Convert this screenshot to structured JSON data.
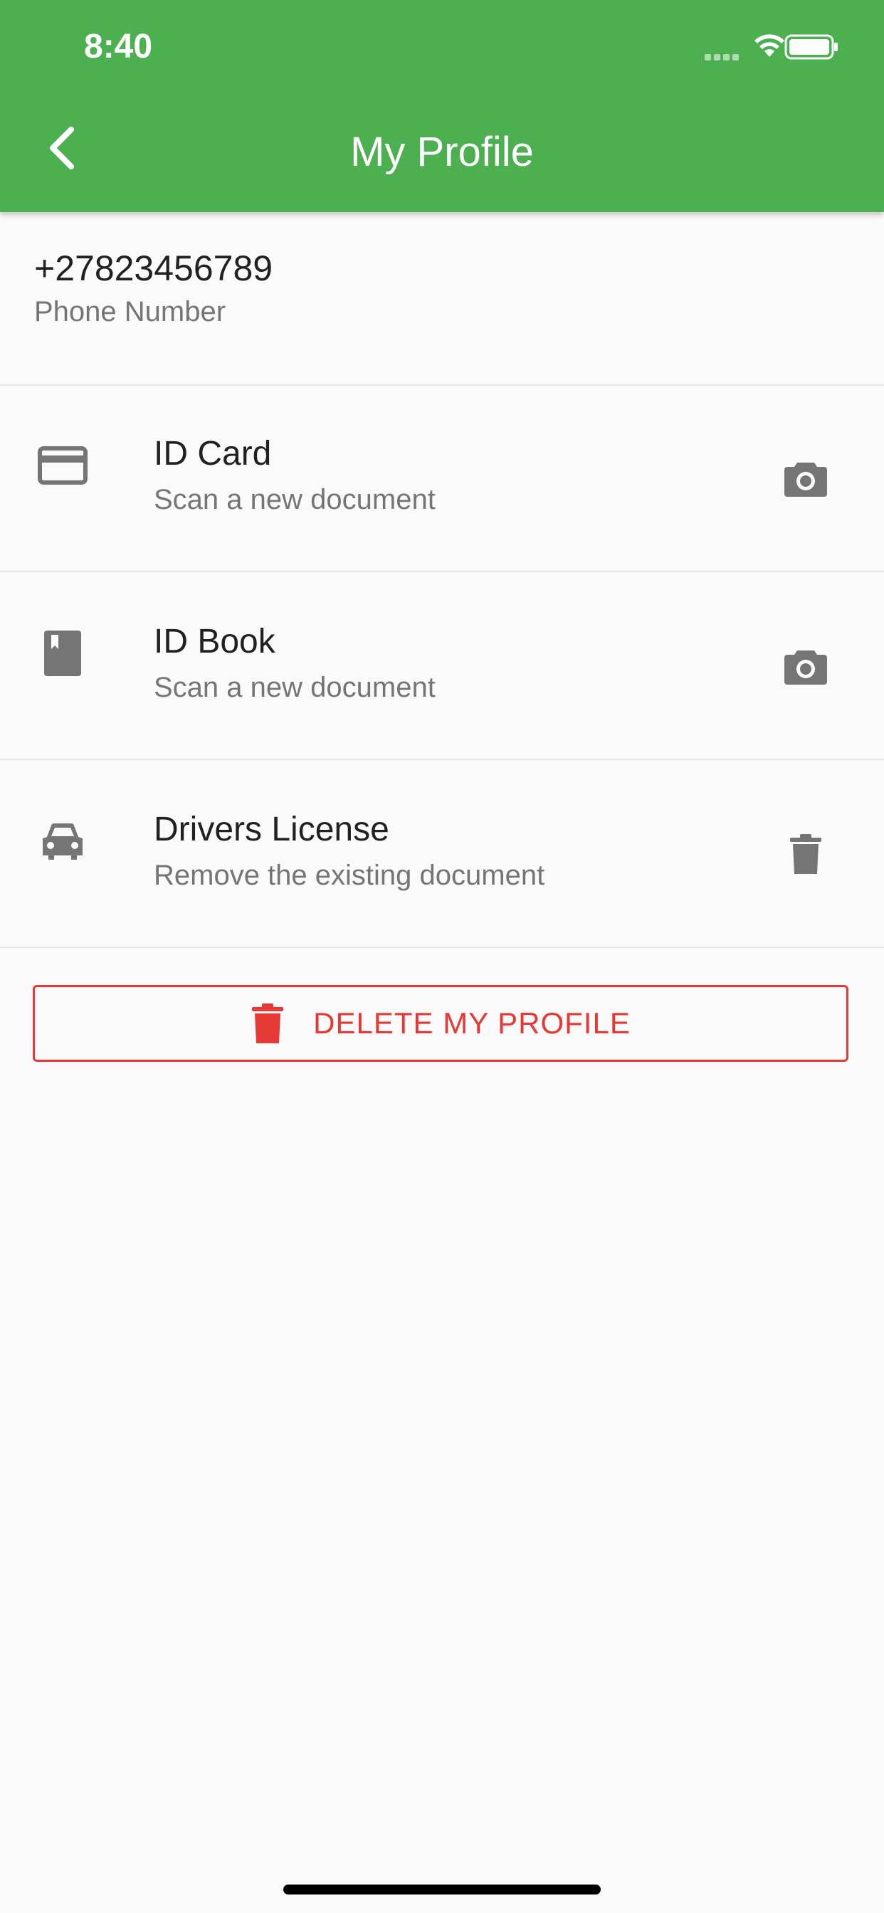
{
  "status_bar": {
    "time": "8:40",
    "icons": [
      "signal-icon",
      "wifi-icon",
      "battery-icon"
    ]
  },
  "app_bar": {
    "title": "My Profile",
    "back_icon": "back-arrow-icon",
    "color": "#4caf50"
  },
  "phone": {
    "value": "+27823456789",
    "label": "Phone Number"
  },
  "documents": [
    {
      "title": "ID Card",
      "subtitle": "Scan a new document",
      "icon": "credit-card-icon",
      "action_icon": "camera-icon"
    },
    {
      "title": "ID Book",
      "subtitle": "Scan a new document",
      "icon": "book-icon",
      "action_icon": "camera-icon"
    },
    {
      "title": "Drivers License",
      "subtitle": "Remove the existing document",
      "icon": "car-icon",
      "action_icon": "trash-icon"
    }
  ],
  "delete_profile": {
    "label": "DELETE MY PROFILE",
    "icon": "trash-icon",
    "color": "#e53935"
  }
}
